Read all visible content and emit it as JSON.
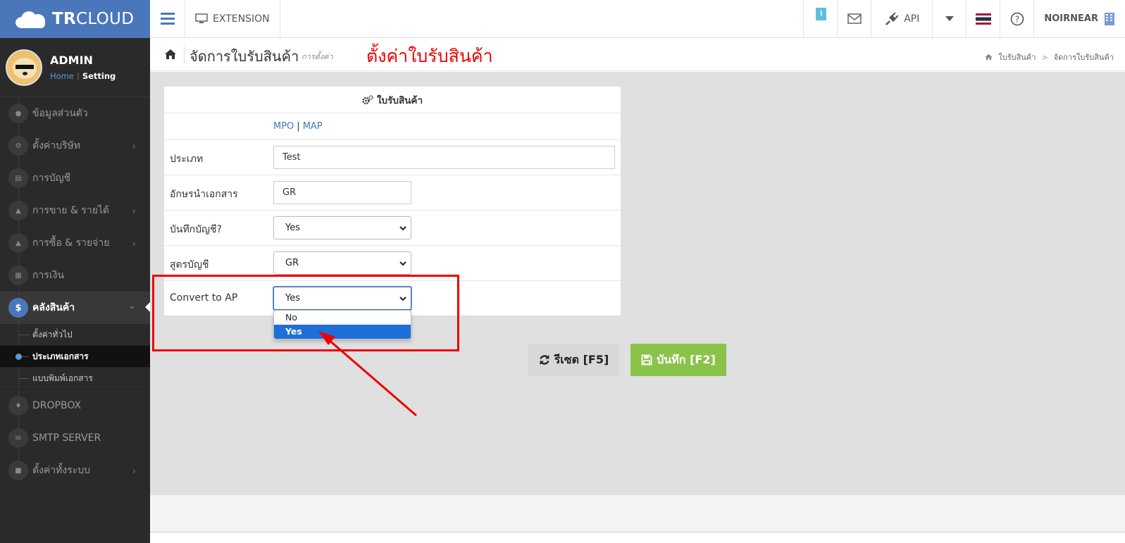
{
  "brand": {
    "bold": "TR",
    "light": "CLOUD",
    "color": "#4a77ba"
  },
  "topbar": {
    "menu_icon": "hamburger-icon",
    "extension_label": "EXTENSION",
    "notification_badge": "!",
    "api_label": "API",
    "user_label": "NOIRNEAR",
    "icons": [
      "monitor-icon",
      "mail-icon",
      "plug-icon",
      "caret-down-icon",
      "thai-flag-icon",
      "help-icon",
      "building-icon"
    ]
  },
  "sidebar": {
    "profile": {
      "name": "ADMIN",
      "home": "Home",
      "separator": "|",
      "setting": "Setting"
    },
    "items": [
      {
        "label": "ข้อมูลส่วนตัว",
        "icon": "user-icon",
        "chevron": false
      },
      {
        "label": "ตั้งค่าบริษัท",
        "icon": "gear-icon",
        "chevron": true
      },
      {
        "label": "การบัญชี",
        "icon": "book-icon",
        "chevron": false
      },
      {
        "label": "การขาย & รายได้",
        "icon": "cart-icon",
        "chevron": true
      },
      {
        "label": "การซื้อ & รายจ่าย",
        "icon": "cart-icon",
        "chevron": true
      },
      {
        "label": "การเงิน",
        "icon": "calendar-icon",
        "chevron": false
      },
      {
        "label": "คลังสินค้า",
        "icon": "dollar-icon",
        "chevron": true,
        "active": true
      },
      {
        "label": "DROPBOX",
        "icon": "dropbox-icon",
        "chevron": false
      },
      {
        "label": "SMTP SERVER",
        "icon": "envelope-icon",
        "chevron": false
      },
      {
        "label": "ตั้งค่าทั้งระบบ",
        "icon": "lock-icon",
        "chevron": true
      }
    ],
    "subitems": [
      {
        "label": "ตั้งค่าทั่วไป"
      },
      {
        "label": "ประเภทเอกสาร",
        "current": true
      },
      {
        "label": "แบบพิมพ์เอกสาร"
      }
    ]
  },
  "header": {
    "title": "จัดการใบรับสินค้า",
    "subtitle": "การตั้งค่า",
    "annotation": "ตั้งค่าใบรับสินค้า",
    "breadcrumb": [
      "ใบรับสินค้า",
      "จัดการใบรับสินค้า"
    ]
  },
  "form": {
    "heading": "ใบรับสินค้า",
    "links": [
      "MPO",
      "MAP"
    ],
    "link_separator": "|",
    "fields": [
      {
        "label": "ประเภท",
        "value": "Test",
        "type": "text"
      },
      {
        "label": "อักษรนำเอกสาร",
        "value": "GR",
        "type": "text"
      },
      {
        "label": "บันทึกบัญชี?",
        "value": "Yes",
        "type": "select"
      },
      {
        "label": "สูตรบัญชี",
        "value": "GR",
        "type": "select"
      },
      {
        "label": "Convert to AP",
        "value": "Yes",
        "type": "select"
      }
    ],
    "dropdown_options": [
      "No",
      "Yes"
    ],
    "dropdown_selected": "Yes"
  },
  "buttons": {
    "reset": "รีเซต [F5]",
    "save": "บันทึก [F2]"
  },
  "colors": {
    "annotation": "#e00000",
    "save": "#8bc34a",
    "reset": "#d8d8d8",
    "sidebar": "#2a2a2a",
    "content_bg": "#e0e0e0"
  }
}
